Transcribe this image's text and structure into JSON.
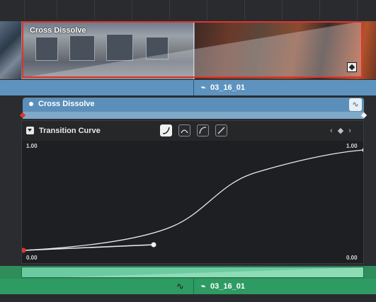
{
  "timeline": {
    "clip_title": "Cross Dissolve",
    "video_clip_name": "03_16_01",
    "audio_clip_name": "03_16_01"
  },
  "transition": {
    "title": "Cross Dissolve"
  },
  "curve_editor": {
    "title": "Transition Curve",
    "label_top_left": "1.00",
    "label_top_right": "1.00",
    "label_bottom_left": "0.00",
    "label_bottom_right": "0.00",
    "presets": [
      "ease-in-icon",
      "ease-both-icon",
      "ease-out-icon",
      "linear-icon"
    ],
    "active_preset": "ease-in-icon",
    "nav_label": "‹ ◆ ›"
  },
  "colors": {
    "accent_red": "#e0352d",
    "video_bar": "#5d93be",
    "audio_bar": "#2e9b62"
  }
}
